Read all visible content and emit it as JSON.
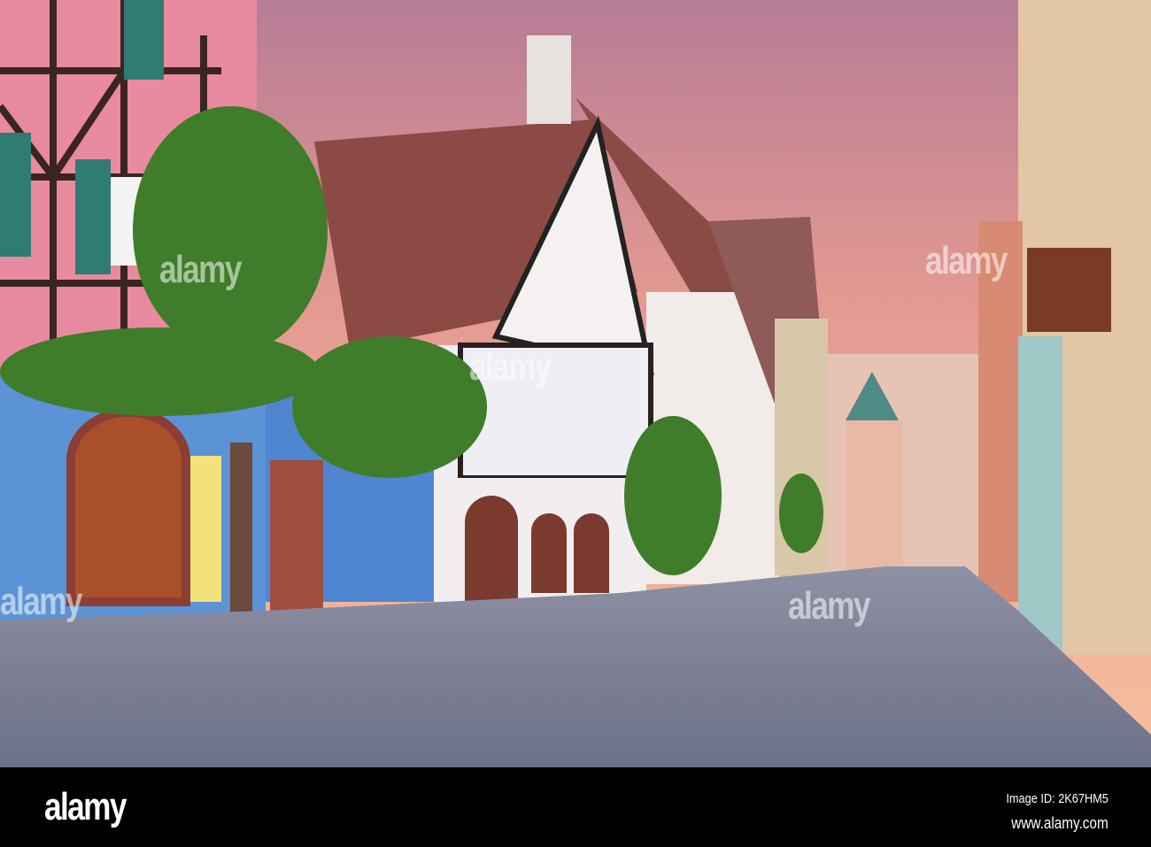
{
  "watermark": {
    "text": "alamy"
  },
  "footer": {
    "logo": "alamy",
    "image_id": "Image ID: 2K67HM5",
    "site": "www.alamy.com"
  },
  "colors": {
    "sky_top": "#c9869a",
    "sky_low": "#f2b08e",
    "street": "#7f8398",
    "pink_wall": "#e88aa0",
    "blue_wall": "#5b93d6",
    "ivy": "#3f7d2a"
  }
}
